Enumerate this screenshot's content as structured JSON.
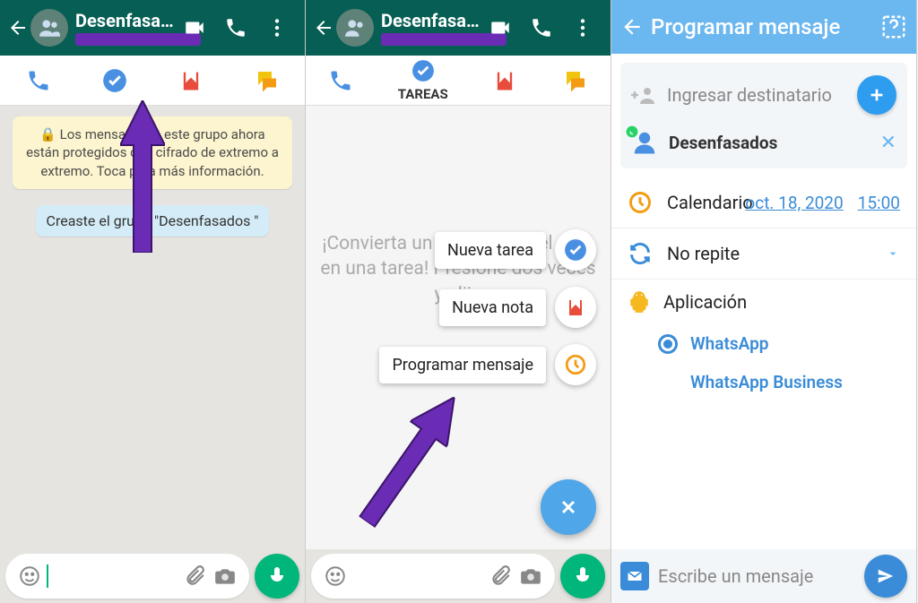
{
  "panel1": {
    "header": {
      "title": "Desenfasad…"
    },
    "info": "🔒 Los mensajes en este grupo ahora están protegidos con cifrado de extremo a extremo. Toca para más información.",
    "sys": "Creaste el grupo \"Desenfasados \""
  },
  "panel2": {
    "header": {
      "title": "Desenfasad…"
    },
    "tab_tasks": "TAREAS",
    "hint": "¡Convierta un mensaje en el chat en una tarea! Presione dos veces y elija",
    "fab": {
      "new_task": "Nueva tarea",
      "new_note": "Nueva nota",
      "schedule": "Programar mensaje"
    }
  },
  "panel3": {
    "title": "Programar mensaje",
    "dest_placeholder": "Ingresar destinatario",
    "recipient": "Desenfasados",
    "calendar_label": "Calendario",
    "date": "oct. 18, 2020",
    "time": "15:00",
    "repeat": "No repite",
    "app_label": "Aplicación",
    "app_whatsapp": "WhatsApp",
    "app_wab": "WhatsApp Business",
    "msg_placeholder": "Escribe un mensaje"
  }
}
